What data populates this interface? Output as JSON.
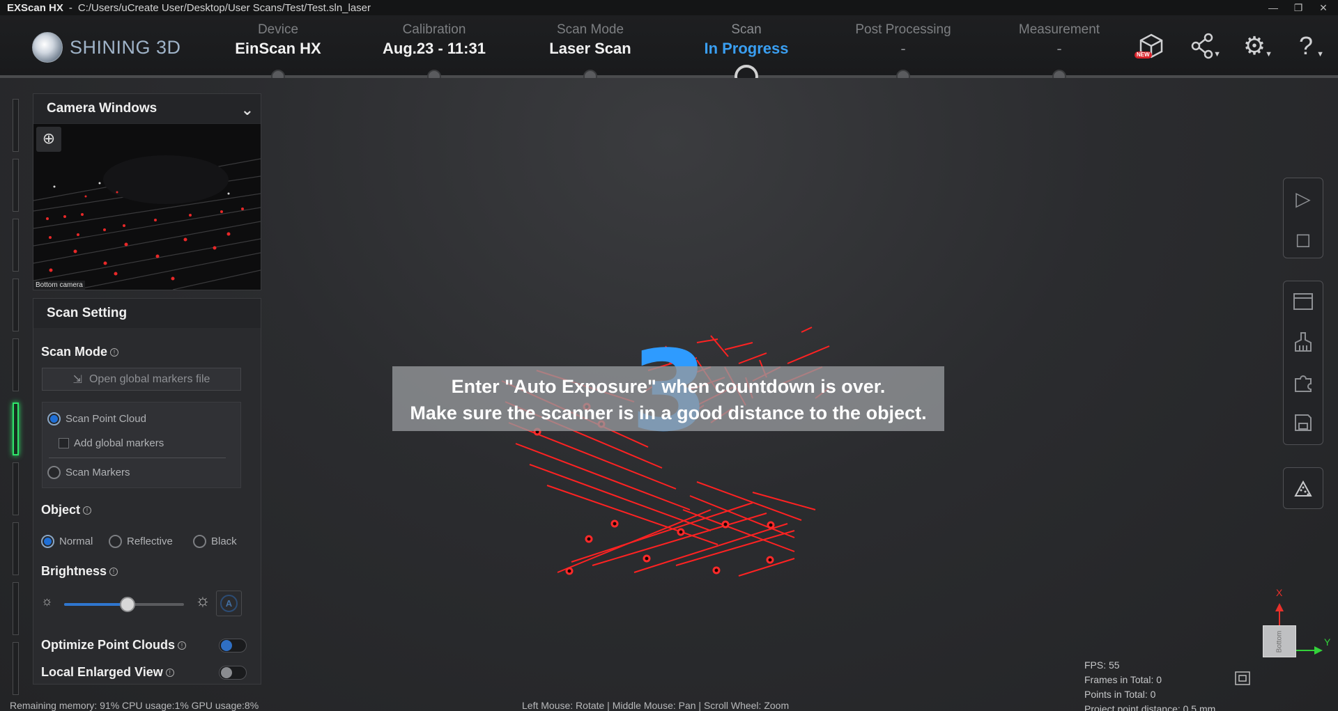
{
  "window": {
    "app": "EXScan HX",
    "separator": "-",
    "path": "C:/Users/uCreate User/Desktop/User Scans/Test/Test.sln_laser"
  },
  "brand": "SHINING 3D",
  "steps": [
    {
      "label": "Device",
      "value": "EinScan HX"
    },
    {
      "label": "Calibration",
      "value": "Aug.23 - 11:31"
    },
    {
      "label": "Scan Mode",
      "value": "Laser Scan"
    },
    {
      "label": "Scan",
      "value": "In Progress"
    },
    {
      "label": "Post Processing",
      "value": "-"
    },
    {
      "label": "Measurement",
      "value": "-"
    }
  ],
  "tools": {
    "new_badge": "NEW"
  },
  "camera": {
    "title": "Camera Windows",
    "label": "Bottom camera"
  },
  "scan_setting": {
    "title": "Scan Setting",
    "scan_mode_label": "Scan Mode",
    "open_markers_label": "Open global markers file",
    "scan_point_cloud": "Scan Point Cloud",
    "add_global_markers": "Add  global markers",
    "scan_markers": "Scan Markers",
    "object_label": "Object",
    "object_options": [
      "Normal",
      "Reflective",
      "Black"
    ],
    "brightness_label": "Brightness",
    "brightness_level": 0.53,
    "auto_label": "A",
    "optimize_label": "Optimize Point Clouds",
    "local_enlarged_label": "Local Enlarged View"
  },
  "overlay": {
    "line1": "Enter \"Auto Exposure\" when countdown is over.",
    "line2": "Make sure the scanner is in a good distance to the object.",
    "countdown": "3"
  },
  "status": {
    "resources": "Remaining memory: 91%  CPU usage:1%  GPU usage:8%",
    "hint": "Left Mouse: Rotate | Middle Mouse: Pan | Scroll Wheel: Zoom"
  },
  "stats": {
    "fps": "FPS:  55",
    "frames": "Frames in Total: 0",
    "points": "Points in Total: 0",
    "distance": "Project point distance: 0.5 mm"
  },
  "axes": {
    "x": "X",
    "y": "Y",
    "view": "Bottom"
  },
  "colors": {
    "accent": "#3a9ff2",
    "active_strip": "#2fe56a",
    "laser": "#ff2020"
  }
}
